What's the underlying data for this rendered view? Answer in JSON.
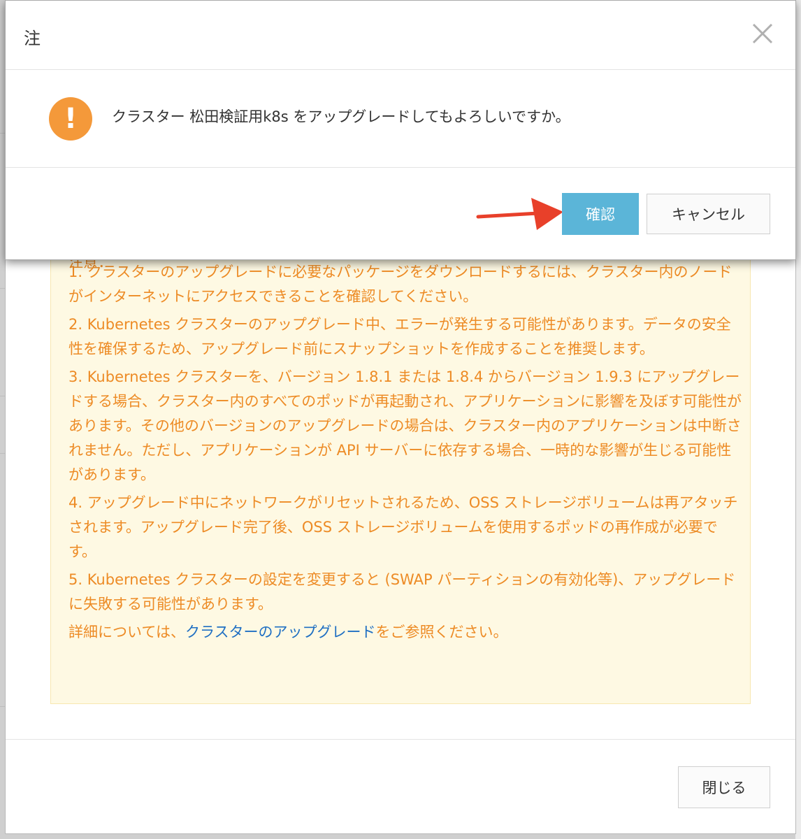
{
  "confirm": {
    "title": "注",
    "message": "クラスター 松田検証用k8s をアップグレードしてもよろしいですか。",
    "ok_label": "確認",
    "cancel_label": "キャンセル"
  },
  "notice": {
    "title": "注意：",
    "items": [
      "1. クラスターのアップグレードに必要なパッケージをダウンロードするには、クラスター内のノードがインターネットにアクセスできることを確認してください。",
      "2. Kubernetes クラスターのアップグレード中、エラーが発生する可能性があります。データの安全性を確保するため、アップグレード前にスナップショットを作成することを推奨します。",
      "3. Kubernetes クラスターを、バージョン 1.8.1 または 1.8.4 からバージョン 1.9.3 にアップグレードする場合、クラスター内のすべてのポッドが再起動され、アプリケーションに影響を及ぼす可能性があります。その他のバージョンのアップグレードの場合は、クラスター内のアプリケーションは中断されません。ただし、アプリケーションが API サーバーに依存する場合、一時的な影響が生じる可能性があります。",
      "4. アップグレード中にネットワークがリセットされるため、OSS ストレージボリュームは再アタッチされます。アップグレード完了後、OSS ストレージボリュームを使用するポッドの再作成が必要です。",
      "5. Kubernetes クラスターの設定を変更すると (SWAP パーティションの有効化等)、アップグレードに失敗する可能性があります。"
    ],
    "details_prefix": "詳細については、",
    "details_link": "クラスターのアップグレード",
    "details_suffix": "をご参照ください。"
  },
  "footer": {
    "close_label": "閉じる"
  },
  "icons": {
    "warning": "exclamation-circle-icon",
    "close": "close-icon",
    "annotation": "red-arrow-icon"
  },
  "colors": {
    "primary": "#5bb5d8",
    "warning": "#f4993a",
    "notice_text": "#ed8b25",
    "notice_bg": "#fef9e3",
    "link": "#1f6fc3",
    "arrow": "#e8402a"
  }
}
